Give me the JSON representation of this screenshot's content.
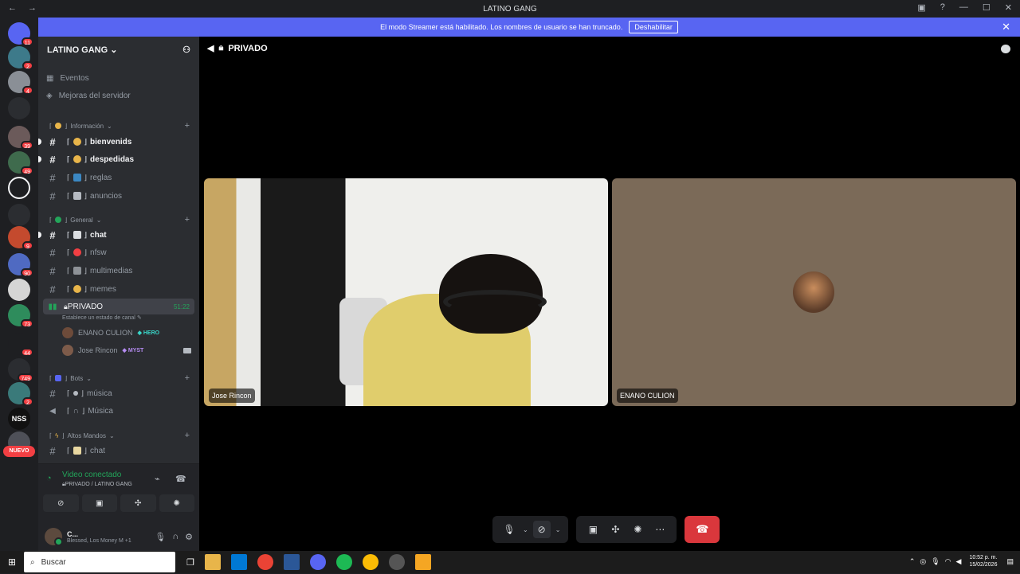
{
  "window": {
    "title": "LATINO GANG"
  },
  "banner": {
    "text": "El modo Streamer está habilitado. Los nombres de usuario se han truncado.",
    "button": "Deshabilitar"
  },
  "server": {
    "name": "LATINO GANG"
  },
  "sidebar": {
    "top_items": [
      {
        "label": "Eventos",
        "icon": "calendar-icon"
      },
      {
        "label": "Mejoras del servidor",
        "icon": "boost-icon"
      }
    ],
    "categories": {
      "informacion": "Información",
      "general": "General",
      "bots": "Bots",
      "altos": "Altos Mandos"
    },
    "channels": {
      "bienvenids": "bienvenids",
      "despedidas": "despedidas",
      "reglas": "reglas",
      "anuncios": "anuncios",
      "chat": "chat",
      "nfsw": "nfsw",
      "multimedias": "multimedias",
      "memes": "memes",
      "privado": "PRIVADO",
      "musica_text": "música",
      "musica_voice": "Música",
      "altos_chat": "chat"
    },
    "privado_time": "51:22",
    "privado_status": "Establece un estado de canal",
    "voice_users": [
      {
        "name": "ENANO CULION",
        "tag": "HERO"
      },
      {
        "name": "Jose Rincon",
        "tag": "MYST"
      }
    ]
  },
  "guild_badges": [
    "11",
    "2",
    "4",
    "",
    "39",
    "49",
    "",
    "",
    "9",
    "28",
    "90",
    "",
    "73",
    "44",
    "749",
    "2",
    ""
  ],
  "new_label": "NUEVO",
  "voice_panel": {
    "status": "Video conectado",
    "location": "PRIVADO / LATINO GANG"
  },
  "user": {
    "name": "C...",
    "status": "Blessed, Los Money M +1"
  },
  "main": {
    "channel": "PRIVADO",
    "tiles": [
      {
        "name": "Jose Rincon"
      },
      {
        "name": "ENANO CULION"
      }
    ]
  },
  "taskbar": {
    "search_placeholder": "Buscar",
    "time": "10:52 p. m.",
    "date": "15/02/2026"
  },
  "colors": {
    "accent": "#5865f2",
    "danger": "#da373c",
    "online": "#23a55a"
  }
}
